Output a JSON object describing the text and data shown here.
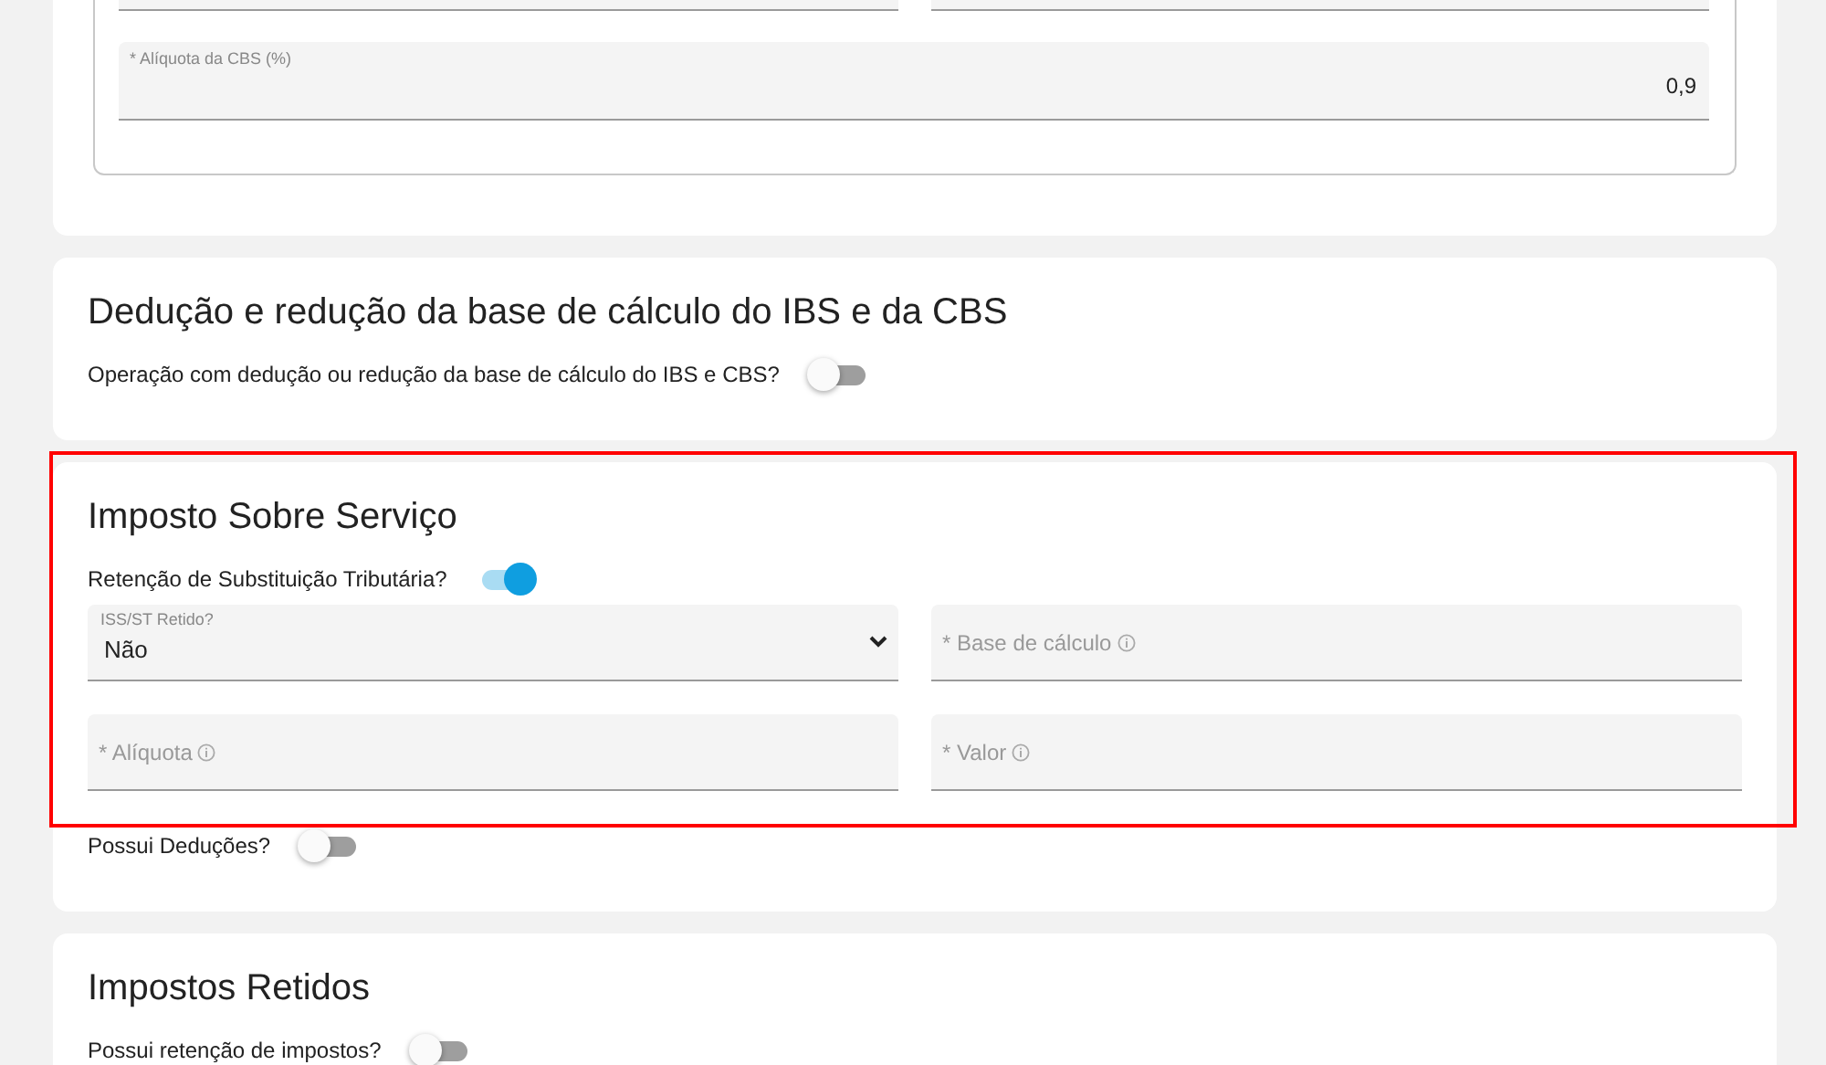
{
  "top_card": {
    "fields": [
      {
        "label": "* Alíquota da CBS (%)",
        "value": "0,9"
      }
    ]
  },
  "sections": [
    {
      "title": "Dedução e redução da base de cálculo do IBS e da CBS",
      "highlighted": false,
      "items": [
        {
          "kind": "toggle",
          "label": "Operação com dedução ou redução da base de cálculo do IBS e CBS?",
          "on": false
        }
      ]
    },
    {
      "title": "Imposto Sobre Serviço",
      "highlighted": true,
      "items": [
        {
          "kind": "toggle",
          "label": "Retenção de Substituição Tributária?",
          "on": true
        },
        {
          "kind": "fields",
          "fields": [
            {
              "kind": "select",
              "label": "ISS/ST Retido?",
              "value": "Não"
            },
            {
              "kind": "input",
              "placeholder": "* Base de cálculo",
              "info": true
            },
            {
              "kind": "input",
              "placeholder": "* Alíquota",
              "info": true
            },
            {
              "kind": "input",
              "placeholder": "* Valor",
              "info": true
            }
          ]
        }
      ],
      "extra_items": [
        {
          "kind": "toggle",
          "label": "Possui Deduções?",
          "on": false
        }
      ]
    },
    {
      "title": "Impostos Retidos",
      "highlighted": false,
      "items": [
        {
          "kind": "toggle",
          "label": "Possui retenção de impostos?",
          "on": false
        }
      ]
    }
  ]
}
